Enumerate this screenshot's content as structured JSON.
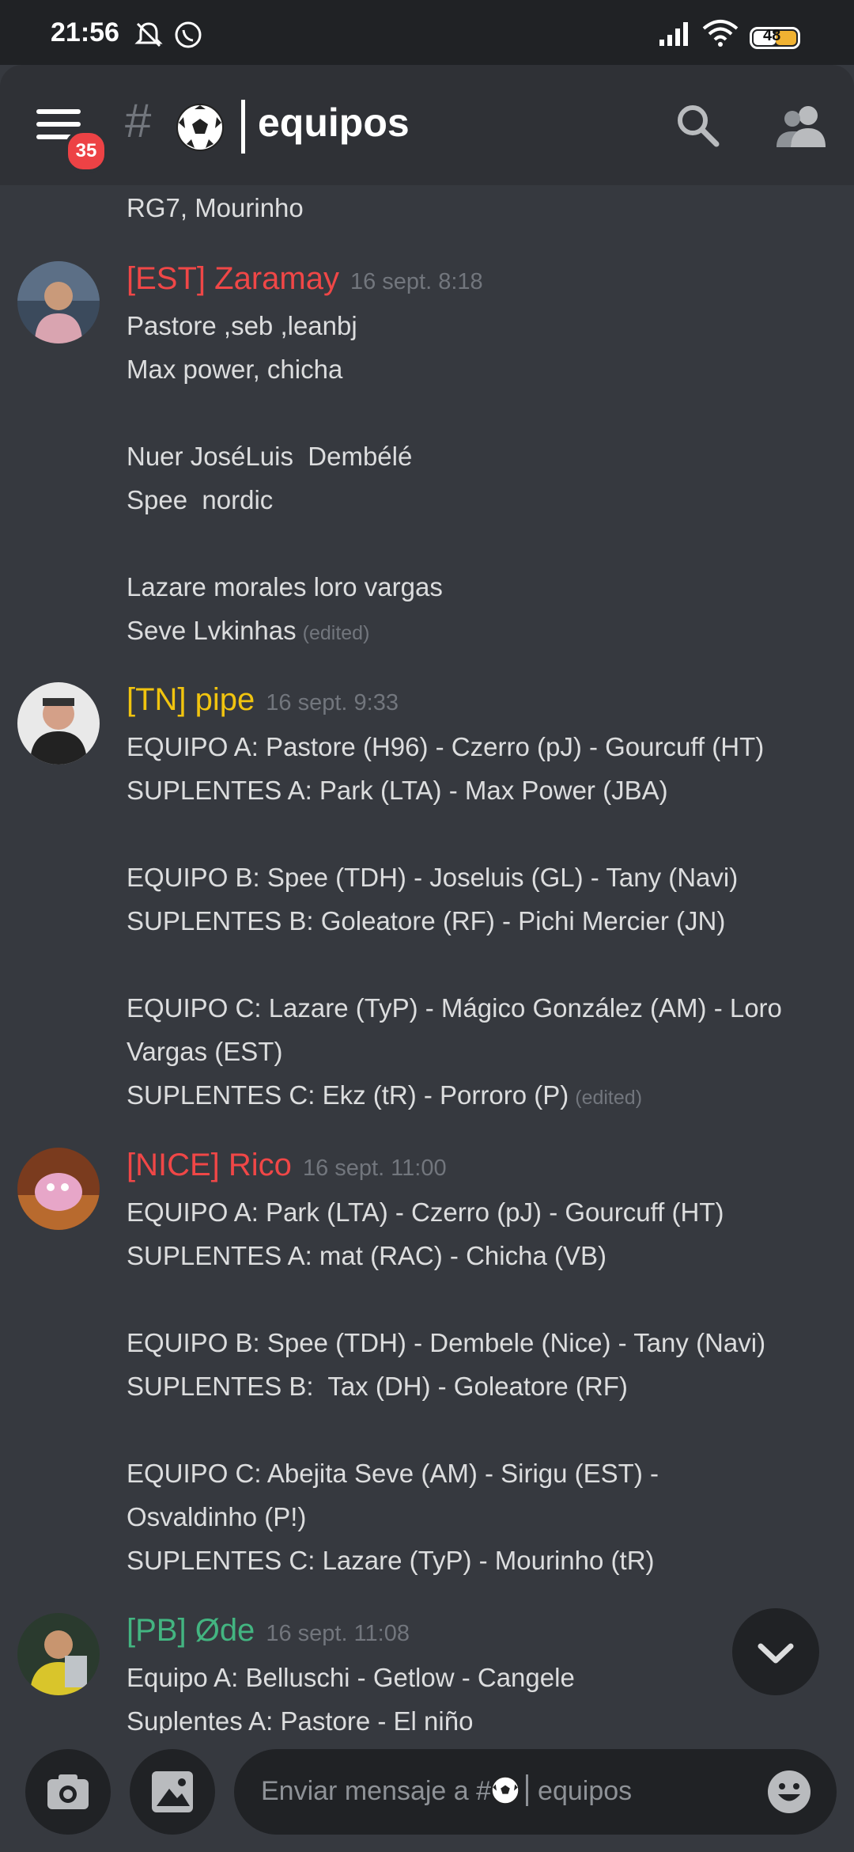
{
  "status_bar": {
    "time": "21:56",
    "battery": "48"
  },
  "header": {
    "unread_badge": "35",
    "hash": "#",
    "channel_name": "equipos",
    "channel_emoji": "soccer-ball"
  },
  "messages": [
    {
      "lines": [
        "RG7, Mourinho"
      ]
    },
    {
      "author": "[EST] Zaramay",
      "author_color": "#f04747",
      "timestamp": "16 sept. 8:18",
      "lines": [
        "Pastore ,seb ,leanbj",
        "Max power, chicha",
        "",
        "Nuer JoséLuis  Dembélé",
        "Spee  nordic",
        "",
        "Lazare morales loro vargas",
        "Seve Lvkinhas"
      ],
      "edited": "(edited)"
    },
    {
      "author": "[TN] pipe",
      "author_color": "#f1c40f",
      "timestamp": "16 sept. 9:33",
      "lines": [
        "EQUIPO A: Pastore (H96) - Czerro (pJ) - Gourcuff (HT)",
        "SUPLENTES A: Park (LTA) - Max Power (JBA)",
        "",
        "EQUIPO B: Spee (TDH) - Joseluis (GL) - Tany (Navi)",
        "SUPLENTES B: Goleatore (RF) - Pichi Mercier (JN)",
        "",
        "EQUIPO C: Lazare (TyP) - Mágico González (AM) - Loro",
        "Vargas (EST)",
        "SUPLENTES C: Ekz (tR) - Porroro (P)"
      ],
      "edited": "(edited)"
    },
    {
      "author": "[NICE] Rico",
      "author_color": "#f04747",
      "timestamp": "16 sept. 11:00",
      "lines": [
        "EQUIPO A: Park (LTA) - Czerro (pJ) - Gourcuff (HT)",
        "SUPLENTES A: mat (RAC) - Chicha (VB)",
        "",
        "EQUIPO B: Spee (TDH) - Dembele (Nice) - Tany (Navi)",
        "SUPLENTES B:  Tax (DH) - Goleatore (RF)",
        "",
        "EQUIPO C: Abejita Seve (AM) - Sirigu (EST) -",
        "Osvaldinho (P!)",
        "SUPLENTES C: Lazare (TyP) - Mourinho (tR)"
      ]
    },
    {
      "author": "[PB] Øde",
      "author_color": "#43b581",
      "timestamp": "16 sept. 11:08",
      "lines": [
        "Equipo A: Belluschi - Getlow - Cangele",
        "Suplentes A: Pastore - El niño"
      ]
    }
  ],
  "composer": {
    "placeholder_prefix": "Enviar mensaje a #",
    "placeholder_channel": "equipos"
  }
}
